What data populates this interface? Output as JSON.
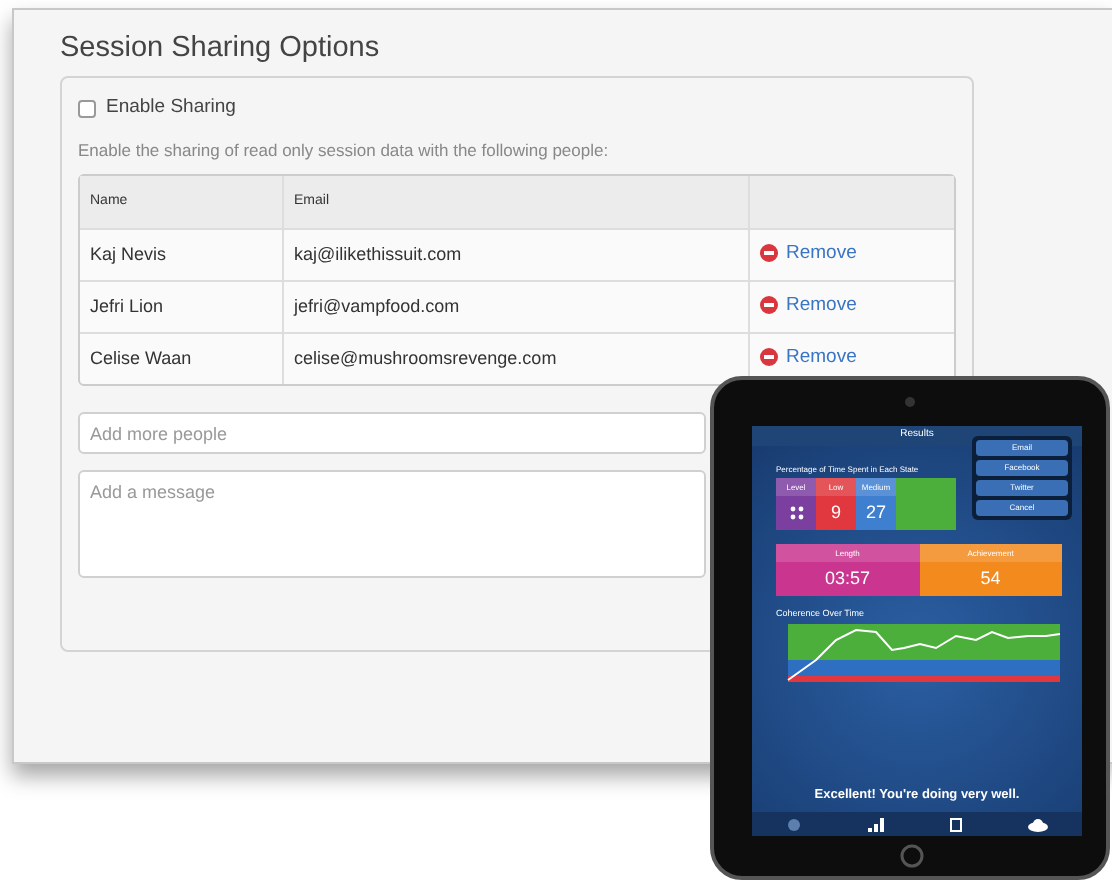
{
  "heading": "Session Sharing Options",
  "enable_sharing": {
    "label": "Enable Sharing",
    "checked": false
  },
  "description": "Enable the sharing of read only session data with the following people:",
  "table": {
    "columns": [
      "Name",
      "Email"
    ],
    "rows": [
      {
        "name": "Kaj Nevis",
        "email": "kaj@ilikethissuit.com",
        "action": "Remove"
      },
      {
        "name": "Jefri Lion",
        "email": "jefri@vampfood.com",
        "action": "Remove"
      },
      {
        "name": "Celise Waan",
        "email": "celise@mushroomsrevenge.com",
        "action": "Remove"
      }
    ]
  },
  "people_field": {
    "placeholder": "Add more people"
  },
  "message_field": {
    "placeholder": "Add a message"
  },
  "tablet": {
    "nav_title": "Results",
    "share_menu": [
      "Email",
      "Facebook",
      "Twitter",
      "Cancel"
    ],
    "section_title": "Percentage of Time Spent in Each State",
    "state_tiles": [
      {
        "kind": "dots",
        "label": "Level",
        "color": "#7b3fa0"
      },
      {
        "kind": "number",
        "label": "Low",
        "value": "9",
        "color": "#e0383e"
      },
      {
        "kind": "number",
        "label": "Medium",
        "value": "27",
        "color": "#3f7fd0"
      },
      {
        "kind": "blank",
        "color": "#4caf3c"
      }
    ],
    "stats": [
      {
        "label": "Length",
        "value": "03:57",
        "color": "#c9358f"
      },
      {
        "label": "Achievement",
        "value": "54",
        "color": "#f28a1e"
      }
    ],
    "chart_title": "Coherence Over Time",
    "message": "Excellent! You're doing very well."
  }
}
